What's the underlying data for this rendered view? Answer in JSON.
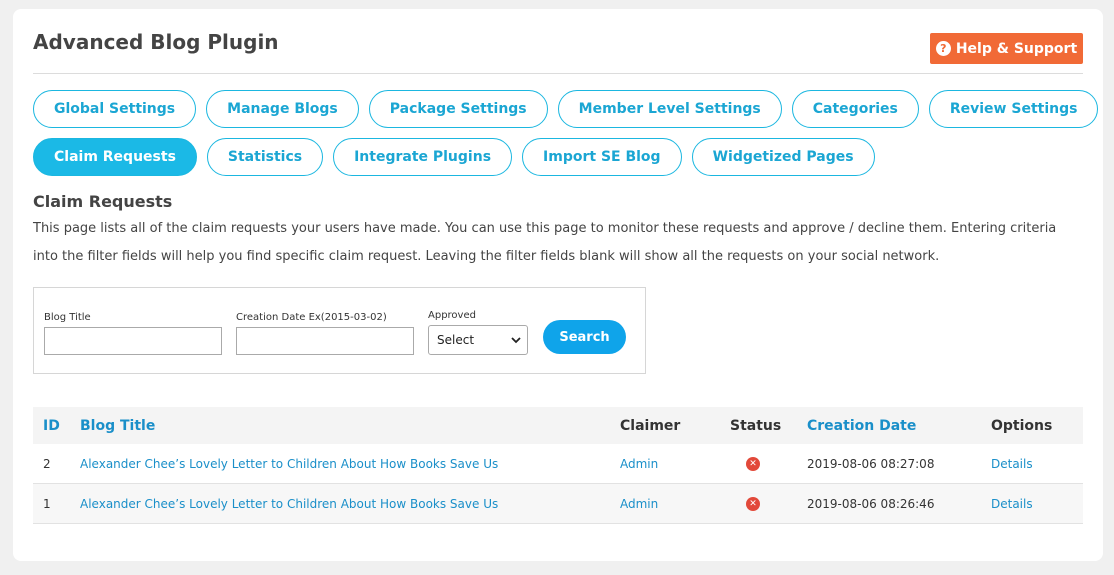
{
  "page": {
    "title": "Advanced Blog Plugin",
    "help_label": "Help & Support"
  },
  "tabs": {
    "row1": [
      {
        "label": "Global Settings"
      },
      {
        "label": "Manage Blogs"
      },
      {
        "label": "Package Settings"
      },
      {
        "label": "Member Level Settings"
      },
      {
        "label": "Categories"
      },
      {
        "label": "Review Settings"
      }
    ],
    "row2": [
      {
        "label": "Claim Requests",
        "active": true
      },
      {
        "label": "Statistics"
      },
      {
        "label": "Integrate Plugins"
      },
      {
        "label": "Import SE Blog"
      },
      {
        "label": "Widgetized Pages"
      }
    ]
  },
  "section": {
    "title": "Claim Requests",
    "description": "This page lists all of the claim requests your users have made. You can use this page to monitor these requests and approve / decline them. Entering criteria into the filter fields will help you find specific claim request. Leaving the filter fields blank will show all the requests on your social network."
  },
  "filter": {
    "blog_title_label": "Blog Title",
    "blog_title_value": "",
    "creation_date_label": "Creation Date Ex(2015-03-02)",
    "creation_date_value": "",
    "approved_label": "Approved",
    "approved_selected": "Select",
    "search_label": "Search"
  },
  "table": {
    "headers": {
      "id": "ID",
      "blog_title": "Blog Title",
      "claimer": "Claimer",
      "status": "Status",
      "creation_date": "Creation Date",
      "options": "Options"
    },
    "rows": [
      {
        "id": "2",
        "blog_title": "Alexander Chee’s Lovely Letter to Children About How Books Save Us",
        "claimer": "Admin",
        "status": "declined",
        "creation_date": "2019-08-06 08:27:08",
        "option": "Details"
      },
      {
        "id": "1",
        "blog_title": "Alexander Chee’s Lovely Letter to Children About How Books Save Us",
        "claimer": "Admin",
        "status": "declined",
        "creation_date": "2019-08-06 08:26:46",
        "option": "Details"
      }
    ]
  },
  "colors": {
    "accent": "#1bb9e6",
    "help_button": "#f16a36",
    "search_button": "#0fa4ea",
    "status_declined": "#e2493a",
    "link": "#1a8fc9"
  }
}
